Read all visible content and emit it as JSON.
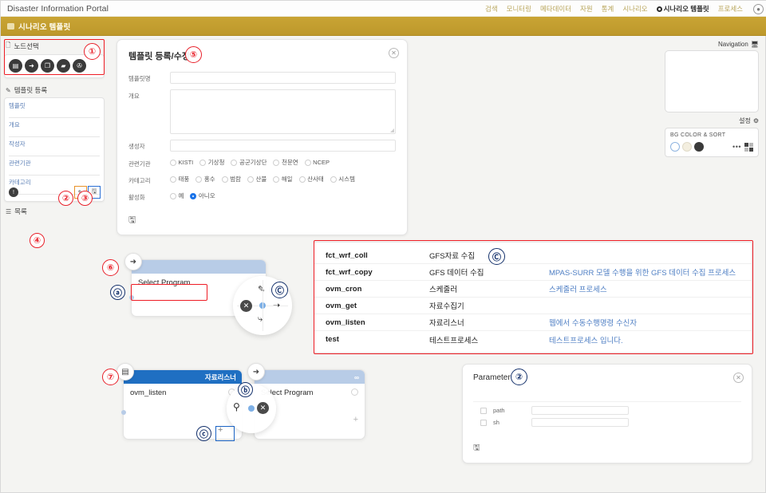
{
  "header": {
    "brand": "Disaster Information Portal",
    "nav_items": [
      {
        "label": "검색",
        "active": false
      },
      {
        "label": "모니터링",
        "active": false
      },
      {
        "label": "메타데이터",
        "active": false
      },
      {
        "label": "자원",
        "active": false
      },
      {
        "label": "통계",
        "active": false
      },
      {
        "label": "시나리오",
        "active": false
      },
      {
        "label": "시나리오 템플릿",
        "active": true
      },
      {
        "label": "프로세스",
        "active": false
      }
    ],
    "user_icon": "user-icon"
  },
  "breadcrumb": {
    "label": "시나리오 템플릿",
    "bg_color": "#c29d2f"
  },
  "sidebar": {
    "node_select": {
      "title": "노드선택",
      "marker": "①",
      "icons": [
        {
          "name": "document-node-icon",
          "glyph": "▤"
        },
        {
          "name": "input-node-icon",
          "glyph": "➜"
        },
        {
          "name": "copy-node-icon",
          "glyph": "❐"
        },
        {
          "name": "image-node-icon",
          "glyph": "▰"
        },
        {
          "name": "link-node-icon",
          "glyph": "✇"
        }
      ]
    },
    "template_register": {
      "title": "템플릿 등록",
      "fields": [
        {
          "label": "템플릿",
          "value": ""
        },
        {
          "label": "개요",
          "value": ""
        },
        {
          "label": "작성자",
          "value": ""
        },
        {
          "label": "관련기관",
          "value": ""
        },
        {
          "label": "카테고리",
          "value": ""
        }
      ],
      "hint_icon": "info-icon",
      "edit_button": {
        "name": "edit-button",
        "marker": "②",
        "glyph": "✎"
      },
      "save_button": {
        "name": "save-button",
        "marker": "③",
        "glyph": "🖫"
      }
    },
    "list_section": {
      "title": "목록",
      "marker": "④"
    }
  },
  "form_panel": {
    "title": "템플릿 등록/수정",
    "marker": "⑤",
    "close_label": "✕",
    "fields": [
      {
        "label": "템플릿명",
        "type": "text",
        "value": ""
      },
      {
        "label": "개요",
        "type": "textarea",
        "value": ""
      },
      {
        "label": "생성자",
        "type": "text",
        "value": ""
      }
    ],
    "radio_groups": [
      {
        "label": "관련기관",
        "options": [
          {
            "label": "KISTI",
            "selected": false
          },
          {
            "label": "기상청",
            "selected": false
          },
          {
            "label": "공군기상단",
            "selected": false
          },
          {
            "label": "천문연",
            "selected": false
          },
          {
            "label": "NCEP",
            "selected": false
          }
        ]
      },
      {
        "label": "카테고리",
        "options": [
          {
            "label": "태풍",
            "selected": false
          },
          {
            "label": "홍수",
            "selected": false
          },
          {
            "label": "범람",
            "selected": false
          },
          {
            "label": "산불",
            "selected": false
          },
          {
            "label": "해일",
            "selected": false
          },
          {
            "label": "산사태",
            "selected": false
          },
          {
            "label": "시스템",
            "selected": false
          }
        ]
      },
      {
        "label": "활성화",
        "options": [
          {
            "label": "예",
            "selected": false
          },
          {
            "label": "아니오",
            "selected": true
          }
        ]
      }
    ],
    "save_glyph": "🖫"
  },
  "navigation_panel": {
    "title": "Navigation",
    "monitor_icon": "monitor-icon",
    "settings_label": "설정",
    "settings_icon": "gear-icon",
    "bg_card": {
      "title": "BG COLOR & SORT",
      "swatches": [
        "#ffffff",
        "#f3eedf",
        "#3a3a3a"
      ],
      "more_label": "•••",
      "grid_icon": "grid-icon"
    }
  },
  "process_table": {
    "marker": "Ⓒ",
    "rows": [
      {
        "code": "fct_wrf_coll",
        "name": "GFS자료 수집",
        "desc": ""
      },
      {
        "code": "fct_wrf_copy",
        "name": "GFS 데이터 수집",
        "desc": "MPAS-SURR 모델 수행을 위한 GFS 데이터 수집 프로세스"
      },
      {
        "code": "ovm_cron",
        "name": "스케줄러",
        "desc": "스케줄러 프로세스"
      },
      {
        "code": "ovm_get",
        "name": "자료수집기",
        "desc": ""
      },
      {
        "code": "ovm_listen",
        "name": "자료리스너",
        "desc": "웹에서 수동수행명령 수신자"
      },
      {
        "code": "test",
        "name": "테스트프로세스",
        "desc": "테스트프로세스 입니다."
      }
    ]
  },
  "graph": {
    "node_top": {
      "marker": "⑥",
      "avatar_icon": "input-node-icon",
      "avatar_glyph": "➜",
      "header_text": "",
      "label": "Select Program",
      "label_marker": "ⓐ",
      "badge": "",
      "plus": "+"
    },
    "radial_menu_top": {
      "items": [
        {
          "name": "edit-pen-icon",
          "glyph": "✎",
          "pos": "top"
        },
        {
          "name": "arrow-right-icon",
          "glyph": "➝",
          "pos": "right"
        },
        {
          "name": "branch-arrow-icon",
          "glyph": "⤷",
          "pos": "bottom"
        },
        {
          "name": "close-icon",
          "glyph": "✕",
          "pos": "left"
        }
      ],
      "highlight_marker": "Ⓒ"
    },
    "node_bottom_left": {
      "marker": "⑦",
      "avatar_icon": "document-node-icon",
      "avatar_glyph": "▤",
      "header_text": "자료리스너",
      "label": "ovm_listen",
      "badge": "",
      "plus": "+",
      "plus_marker": "ⓒ"
    },
    "node_bottom_right": {
      "avatar_icon": "input-node-icon",
      "avatar_glyph": "➜",
      "header_text": "∞",
      "label": "Select Program",
      "badge": "",
      "plus": "+"
    },
    "radial_menu_bottom": {
      "marker": "ⓑ",
      "items": [
        {
          "name": "unlink-icon",
          "glyph": "⚲",
          "pos": "left"
        },
        {
          "name": "close-icon",
          "glyph": "✕",
          "pos": "right"
        }
      ]
    }
  },
  "parameter_panel": {
    "title": "Parameter",
    "marker": "②",
    "close_label": "✕",
    "rows": [
      {
        "name": "path",
        "value": "",
        "checked": false
      },
      {
        "name": "sh",
        "value": "",
        "checked": false
      }
    ],
    "save_glyph": "🖫"
  }
}
